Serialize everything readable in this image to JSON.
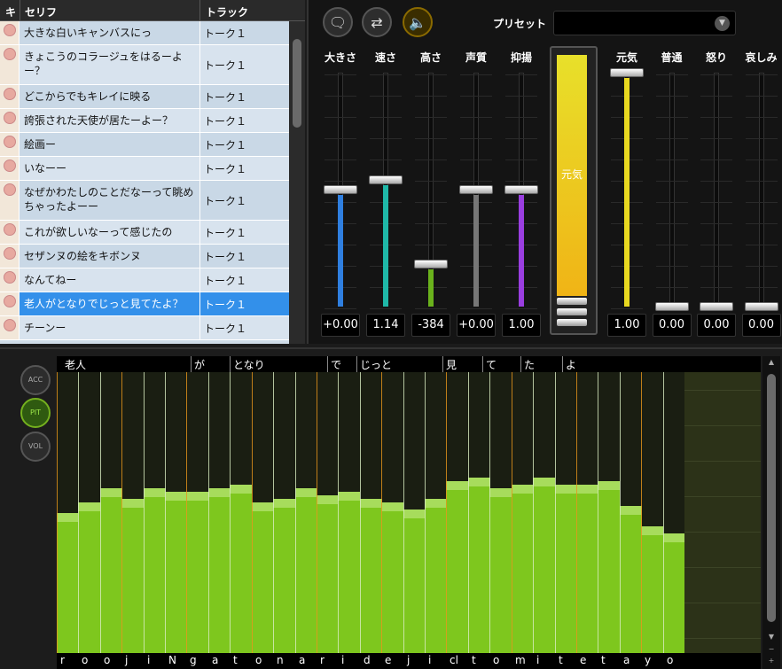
{
  "list": {
    "headers": [
      "キ",
      "セリフ",
      "トラック"
    ],
    "rows": [
      {
        "text": "大きな白いキャンバスにっ",
        "track": "トーク１",
        "h": 27
      },
      {
        "text": "きょこうのコラージュをはるーよー？",
        "track": "トーク１",
        "h": 45
      },
      {
        "text": "どこからでもキレイに映る",
        "track": "トーク１",
        "h": 27
      },
      {
        "text": "誇張された天使が居たーよー？",
        "track": "トーク１",
        "h": 27
      },
      {
        "text": "絵画ー",
        "track": "トーク１",
        "h": 27
      },
      {
        "text": "いなーー",
        "track": "トーク１",
        "h": 27
      },
      {
        "text": "なぜかわたしのことだなーって眺めちゃったよーー",
        "track": "トーク１",
        "h": 45
      },
      {
        "text": "これが欲しいなーって感じたの",
        "track": "トーク１",
        "h": 27
      },
      {
        "text": "セザンヌの絵をキボンヌ",
        "track": "トーク１",
        "h": 27
      },
      {
        "text": "なんてねー",
        "track": "トーク１",
        "h": 27
      },
      {
        "text": "老人がとなりでじっと見てたよ？",
        "track": "トーク１",
        "h": 27,
        "selected": true
      },
      {
        "text": "チーンー",
        "track": "トーク１",
        "h": 27
      }
    ]
  },
  "toolbar": {
    "preset_label": "プリセット",
    "preset_value": ""
  },
  "sliders": [
    {
      "label": "大きさ",
      "value": "+0.00",
      "level": 0.5,
      "color": "#2f7fe0"
    },
    {
      "label": "速さ",
      "value": "1.14",
      "level": 0.54,
      "color": "#1fb8a8"
    },
    {
      "label": "高さ",
      "value": "-384",
      "level": 0.18,
      "color": "#6ab21c"
    },
    {
      "label": "声質",
      "value": "+0.00",
      "level": 0.5,
      "color": "#777777"
    },
    {
      "label": "抑揚",
      "value": "1.00",
      "level": 0.5,
      "color": "#9a3ee0"
    }
  ],
  "emotion_bar": {
    "label": "元気"
  },
  "emotions": [
    {
      "label": "元気",
      "value": "1.00",
      "level": 1.0,
      "color": "#e8d820"
    },
    {
      "label": "普通",
      "value": "0.00",
      "level": 0.0,
      "color": "#777777"
    },
    {
      "label": "怒り",
      "value": "0.00",
      "level": 0.0,
      "color": "#777777"
    },
    {
      "label": "哀しみ",
      "value": "0.00",
      "level": 0.0,
      "color": "#777777"
    }
  ],
  "modes": [
    "ACC",
    "PIT",
    "VOL"
  ],
  "active_mode": "PIT",
  "lyrics": [
    {
      "text": "老人",
      "pos": 0.011
    },
    {
      "text": "が",
      "pos": 0.195
    },
    {
      "text": "となり",
      "pos": 0.251
    },
    {
      "text": "で",
      "pos": 0.389
    },
    {
      "text": "じっと",
      "pos": 0.431
    },
    {
      "text": "見",
      "pos": 0.553
    },
    {
      "text": "て",
      "pos": 0.609
    },
    {
      "text": "た",
      "pos": 0.664
    },
    {
      "text": "よ",
      "pos": 0.723
    }
  ],
  "phonemes": [
    "r",
    "o",
    "o",
    "j",
    "i",
    "N",
    "g",
    "a",
    "t",
    "o",
    "n",
    "a",
    "r",
    "i",
    "d",
    "e",
    "j",
    "i",
    "cl",
    "t",
    "o",
    "m",
    "i",
    "t",
    "e",
    "t",
    "a",
    "y",
    "o"
  ],
  "pitch": [
    0.4,
    0.43,
    0.47,
    0.44,
    0.47,
    0.46,
    0.46,
    0.47,
    0.48,
    0.43,
    0.44,
    0.47,
    0.45,
    0.46,
    0.44,
    0.43,
    0.41,
    0.44,
    0.49,
    0.5,
    0.47,
    0.48,
    0.5,
    0.48,
    0.48,
    0.49,
    0.42,
    0.36,
    0.34
  ]
}
